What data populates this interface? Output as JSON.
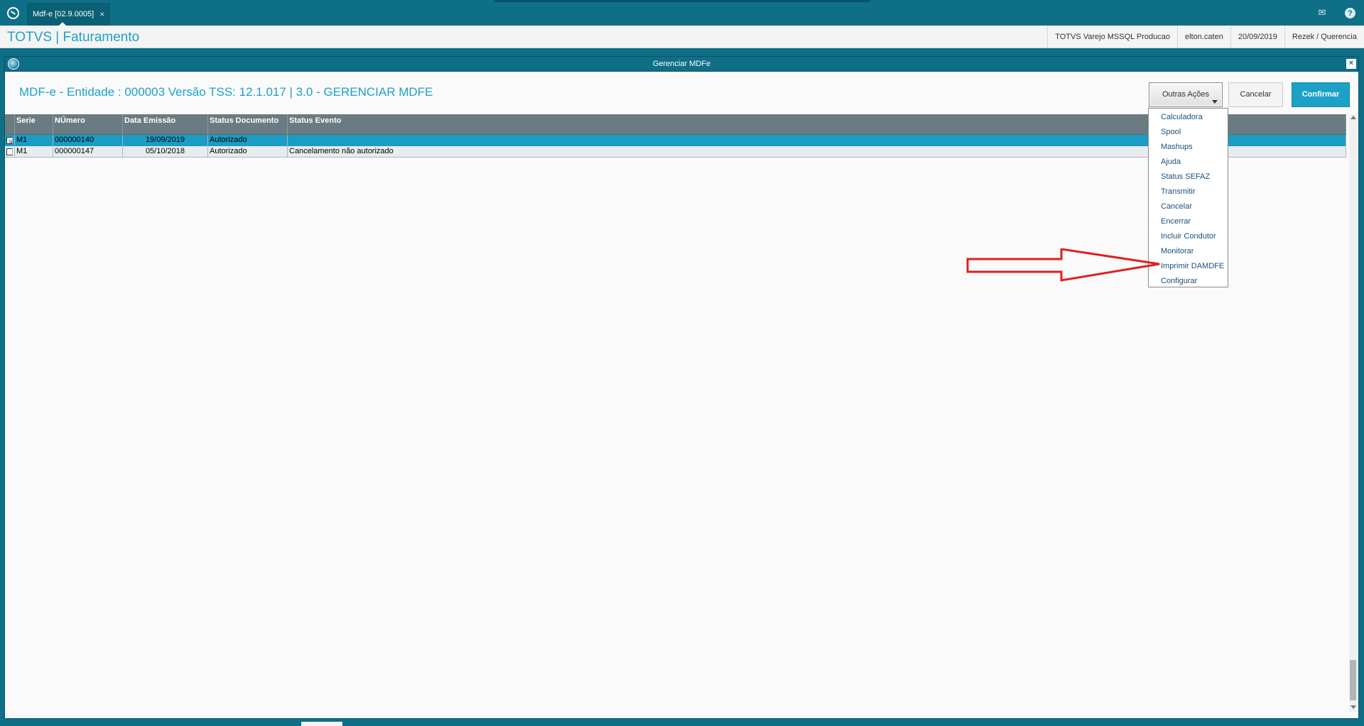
{
  "topbar": {
    "tab_label": "Mdf-e [02.9.0005]",
    "tab_close": "×"
  },
  "app": {
    "title": "TOTVS | Faturamento",
    "environment": "TOTVS Varejo MSSQL Producao",
    "user": "elton.caten",
    "date": "20/09/2019",
    "company": "Rezek / Querencia"
  },
  "dialog": {
    "title": "Gerenciar MDFe",
    "close": "×",
    "heading": "MDF-e - Entidade : 000003 Versão TSS: 12.1.017 | 3.0 - GERENCIAR MDFE",
    "buttons": {
      "other_actions": "Outras Ações",
      "cancel": "Cancelar",
      "confirm": "Confirmar"
    }
  },
  "grid": {
    "columns": [
      "Serie",
      "NÚmero",
      "Data Emissão",
      "Status Documento",
      "Status Evento"
    ],
    "rows": [
      {
        "checked": "☒",
        "serie": "M1",
        "numero": "000000140",
        "data": "19/09/2019",
        "status": "Autorizado",
        "evento": ""
      },
      {
        "checked": "",
        "serie": "M1",
        "numero": "000000147",
        "data": "05/10/2018",
        "status": "Autorizado",
        "evento": "Cancelamento não autorizado"
      }
    ]
  },
  "menu": {
    "items": [
      "Calculadora",
      "Spool",
      "Mashups",
      "Ajuda",
      "Status SEFAZ",
      "Transmitir",
      "Cancelar",
      "Encerrar",
      "Incluir Condutor",
      "Monitorar",
      "Imprimir DAMDFE",
      "Configurar"
    ]
  },
  "colors": {
    "accent": "#1da1c9",
    "topbar": "#0e6f86",
    "annotation_arrow": "#e02020"
  },
  "icons": [
    "totvs-logo-icon",
    "mail-icon",
    "help-icon",
    "dialog-app-icon",
    "close-icon",
    "chevron-down-icon",
    "red-arrow-annotation"
  ]
}
